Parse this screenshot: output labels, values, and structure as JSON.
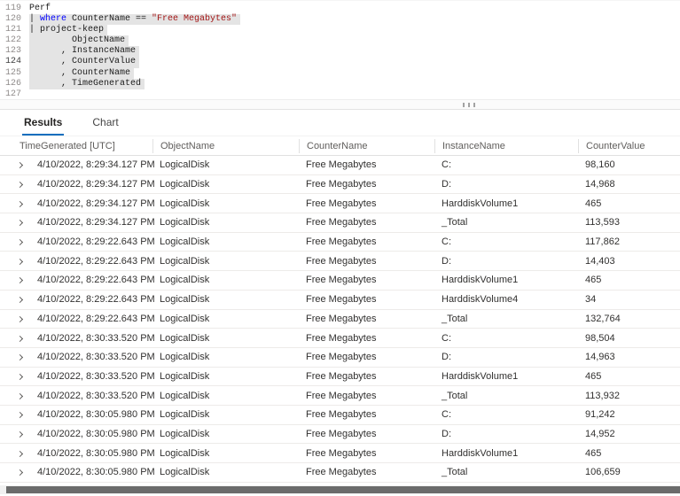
{
  "editor": {
    "lines": [
      {
        "num": "119",
        "selected": false,
        "active": false,
        "tokens": [
          [
            "plain",
            "Perf"
          ]
        ]
      },
      {
        "num": "120",
        "selected": true,
        "active": false,
        "tokens": [
          [
            "plain",
            "| "
          ],
          [
            "kw",
            "where"
          ],
          [
            "plain",
            " CounterName == "
          ],
          [
            "str",
            "\"Free Megabytes\""
          ]
        ]
      },
      {
        "num": "121",
        "selected": true,
        "active": false,
        "tokens": [
          [
            "plain",
            "| project-keep"
          ]
        ]
      },
      {
        "num": "122",
        "selected": true,
        "active": false,
        "tokens": [
          [
            "plain",
            "        ObjectName"
          ]
        ]
      },
      {
        "num": "123",
        "selected": true,
        "active": false,
        "tokens": [
          [
            "plain",
            "      , InstanceName"
          ]
        ]
      },
      {
        "num": "124",
        "selected": true,
        "active": true,
        "tokens": [
          [
            "plain",
            "      , CounterValue"
          ]
        ]
      },
      {
        "num": "125",
        "selected": true,
        "active": false,
        "tokens": [
          [
            "plain",
            "      , CounterName"
          ]
        ]
      },
      {
        "num": "126",
        "selected": true,
        "active": false,
        "tokens": [
          [
            "plain",
            "      , TimeGenerated"
          ]
        ]
      },
      {
        "num": "127",
        "selected": false,
        "active": false,
        "tokens": []
      }
    ]
  },
  "tabs": [
    {
      "label": "Results",
      "active": true
    },
    {
      "label": "Chart",
      "active": false
    }
  ],
  "table": {
    "columns": [
      "TimeGenerated [UTC]",
      "ObjectName",
      "CounterName",
      "InstanceName",
      "CounterValue"
    ],
    "rows": [
      [
        "4/10/2022, 8:29:34.127 PM",
        "LogicalDisk",
        "Free Megabytes",
        "C:",
        "98,160"
      ],
      [
        "4/10/2022, 8:29:34.127 PM",
        "LogicalDisk",
        "Free Megabytes",
        "D:",
        "14,968"
      ],
      [
        "4/10/2022, 8:29:34.127 PM",
        "LogicalDisk",
        "Free Megabytes",
        "HarddiskVolume1",
        "465"
      ],
      [
        "4/10/2022, 8:29:34.127 PM",
        "LogicalDisk",
        "Free Megabytes",
        "_Total",
        "113,593"
      ],
      [
        "4/10/2022, 8:29:22.643 PM",
        "LogicalDisk",
        "Free Megabytes",
        "C:",
        "117,862"
      ],
      [
        "4/10/2022, 8:29:22.643 PM",
        "LogicalDisk",
        "Free Megabytes",
        "D:",
        "14,403"
      ],
      [
        "4/10/2022, 8:29:22.643 PM",
        "LogicalDisk",
        "Free Megabytes",
        "HarddiskVolume1",
        "465"
      ],
      [
        "4/10/2022, 8:29:22.643 PM",
        "LogicalDisk",
        "Free Megabytes",
        "HarddiskVolume4",
        "34"
      ],
      [
        "4/10/2022, 8:29:22.643 PM",
        "LogicalDisk",
        "Free Megabytes",
        "_Total",
        "132,764"
      ],
      [
        "4/10/2022, 8:30:33.520 PM",
        "LogicalDisk",
        "Free Megabytes",
        "C:",
        "98,504"
      ],
      [
        "4/10/2022, 8:30:33.520 PM",
        "LogicalDisk",
        "Free Megabytes",
        "D:",
        "14,963"
      ],
      [
        "4/10/2022, 8:30:33.520 PM",
        "LogicalDisk",
        "Free Megabytes",
        "HarddiskVolume1",
        "465"
      ],
      [
        "4/10/2022, 8:30:33.520 PM",
        "LogicalDisk",
        "Free Megabytes",
        "_Total",
        "113,932"
      ],
      [
        "4/10/2022, 8:30:05.980 PM",
        "LogicalDisk",
        "Free Megabytes",
        "C:",
        "91,242"
      ],
      [
        "4/10/2022, 8:30:05.980 PM",
        "LogicalDisk",
        "Free Megabytes",
        "D:",
        "14,952"
      ],
      [
        "4/10/2022, 8:30:05.980 PM",
        "LogicalDisk",
        "Free Megabytes",
        "HarddiskVolume1",
        "465"
      ],
      [
        "4/10/2022, 8:30:05.980 PM",
        "LogicalDisk",
        "Free Megabytes",
        "_Total",
        "106,659"
      ]
    ]
  },
  "icons": {
    "splitter_grip": "splitter-grip-icon",
    "row_expand": "chevron-right-icon"
  },
  "colors": {
    "tab_accent": "#106ebe",
    "kw": "#0000ff",
    "str": "#a31515",
    "selection": "#e4e4e4",
    "scroll_thumb": "#6b6b6b"
  }
}
